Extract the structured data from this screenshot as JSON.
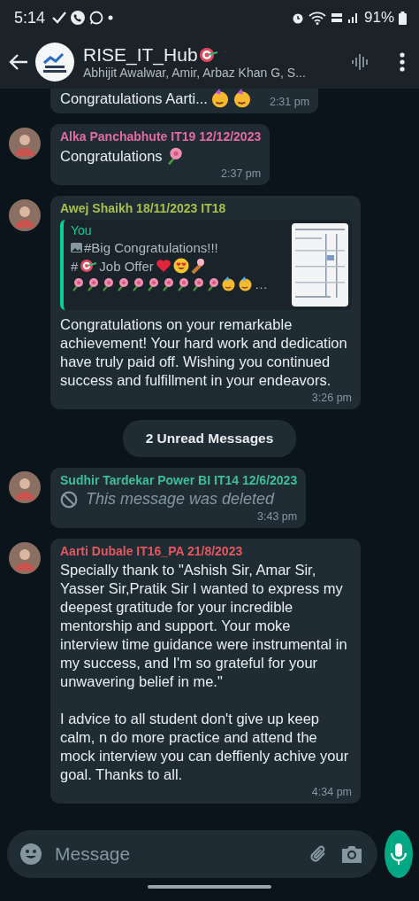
{
  "status_bar": {
    "time": "5:14",
    "battery": "91%"
  },
  "header": {
    "title": "RISE_IT_Hub",
    "subtitle": "Abhijit Awalwar, Amir, Arbaz Khan G, S..."
  },
  "messages": [
    {
      "kind": "text",
      "text": "Congratulations Aarti...",
      "time": "2:31 pm"
    },
    {
      "kind": "text",
      "sender": "Alka Panchabhute IT19 12/12/2023",
      "color": "#e46aa6",
      "text": "Congratulations",
      "time": "2:37 pm"
    },
    {
      "kind": "reply",
      "sender": "Awej Shaikh 18/11/2023 IT18",
      "color": "#a7c04a",
      "quote": {
        "author": "You",
        "line_1": "#Big Congratulations!!!",
        "line_2_prefix": "#",
        "line_2": "Job Offer",
        "line_3": "…",
        "kind": "picture"
      },
      "text": "Congratulations on your remarkable achievement! Your hard work and dedication have truly paid off. Wishing you continued success and fulfillment in your endeavors.",
      "time": "3:26 pm"
    },
    {
      "kind": "unread",
      "label": "2 Unread Messages"
    },
    {
      "kind": "deleted",
      "sender": "Sudhir Tardekar Power BI IT14 12/6/2023",
      "color": "#3cbf98",
      "text": "This message was deleted",
      "time": "3:43 pm"
    },
    {
      "kind": "text",
      "sender": "Aarti Dubale IT16_PA 21/8/2023",
      "color": "#e5575f",
      "text": "Specially thank to \"Ashish Sir, Amar Sir, Yasser Sir,Pratik Sir I wanted to express my deepest gratitude for your incredible mentorship and support. Your moke interview time guidance were instrumental in my success, and I'm so grateful for your unwavering belief in me.\"\n\n I advice to all student don't give up keep calm, n do more practice and attend the mock interview you can deffienly achive your goal. Thanks to all.",
      "time": "4:34 pm"
    }
  ],
  "composer": {
    "placeholder": "Message"
  }
}
